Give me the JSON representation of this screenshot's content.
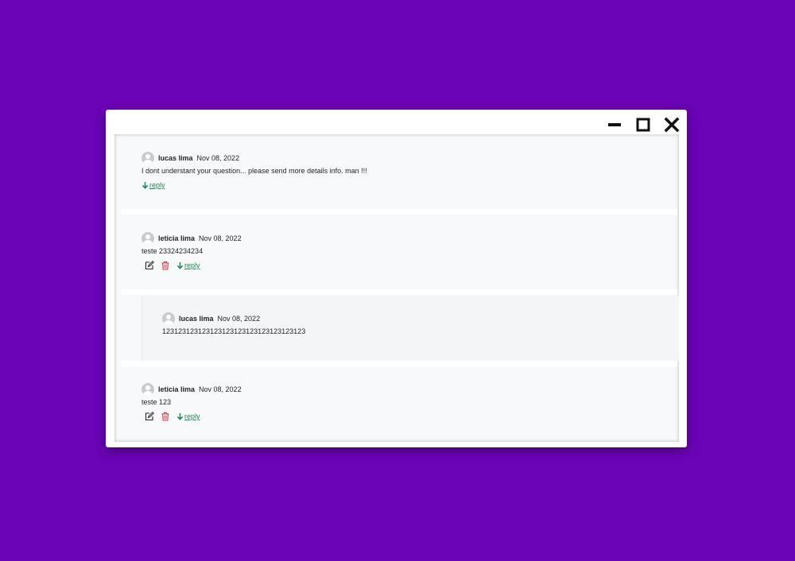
{
  "colors": {
    "background": "#6a04b6",
    "reply_link": "#198754",
    "delete_icon": "#dc3545",
    "edit_icon": "#212529"
  },
  "window": {
    "controls": [
      "minimize-icon",
      "maximize-icon",
      "close-icon"
    ]
  },
  "comments": [
    {
      "author": "lucas lima",
      "date": "Nov 08, 2022",
      "text": "I dont understant your question... please send more details info. man !!!",
      "actions": {
        "reply_label": "reply"
      }
    },
    {
      "author": "leticia lima",
      "date": "Nov 08, 2022",
      "text": "teste 23324234234",
      "actions": {
        "edit_icon": "edit-icon",
        "delete_icon": "trash-icon",
        "reply_label": "reply"
      }
    },
    {
      "author": "lucas lima",
      "date": "Nov 08, 2022",
      "text": "123123123123123123123123123123123123",
      "is_reply": true
    },
    {
      "author": "leticia lima",
      "date": "Nov 08, 2022",
      "text": "teste 123",
      "actions": {
        "edit_icon": "edit-icon",
        "delete_icon": "trash-icon",
        "reply_label": "reply"
      }
    }
  ]
}
